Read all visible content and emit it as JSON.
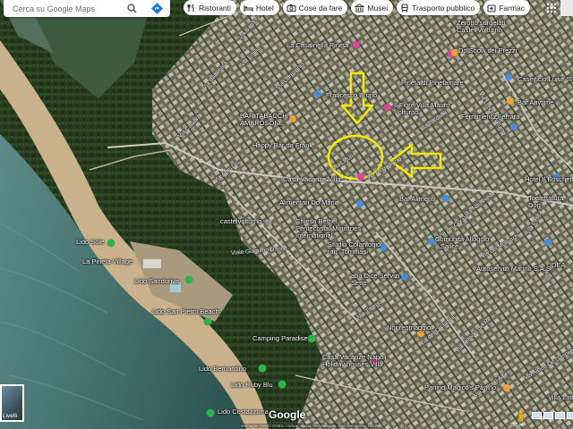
{
  "search": {
    "placeholder": "Cerca su Google Maps"
  },
  "chips": [
    {
      "label": "Ristoranti",
      "icon": "fork-knife-icon"
    },
    {
      "label": "Hotel",
      "icon": "bed-icon"
    },
    {
      "label": "Cose da fare",
      "icon": "camera-icon"
    },
    {
      "label": "Musei",
      "icon": "museum-icon"
    },
    {
      "label": "Trasporto pubblico",
      "icon": "train-icon"
    },
    {
      "label": "Farmac",
      "icon": "pharmacy-icon"
    }
  ],
  "map": {
    "places": {
      "castelvolturno": "Zerotto surgelati Castel Volturno",
      "showprezzi": "Do Show dei Prezzi",
      "casapineta": "La Casa nella Pineta",
      "caseificio": "Caseificio Luise S.r.l",
      "pineta": "Pineta di Pinetamare",
      "francesco": "Francesco Bruno",
      "barany": "Bar Anytime",
      "mauro": "Il Fiore Villa Mauro Volturno",
      "ferramenta": "Ferramenta Ferrara",
      "bambi": "BAR TABACCHI AMBROSONE",
      "happy": "Happy Bar da Frank",
      "hotel": "Hotel Il Boschetto",
      "toelettatura": "Toelettatura Dog",
      "casavacanze": "Casa Vacanze Villa",
      "alimentari": "Alimentari Do Maria",
      "bar_alimenti": "Bar Alimenti",
      "castelvolturno2": "castelvolturno",
      "chiesa": "Chiesa Bethel Pentecostal Ministries International",
      "studio": "Studio Colantonio rag. Tommasi",
      "comunita": "Comunità Alloggio Il Salice",
      "autoservizi": "Autoservizi Marino S.A.S",
      "idea": "IDEA",
      "aba": "aba Dice Servizi Sette",
      "lidosole": "Lido Sole",
      "pineta_village": "La Pineta Village",
      "sandoriva": "Lido Sandoriva",
      "sanpietro": "Lido San Pietro Beach",
      "camping": "Camping Paradise",
      "napoli": "Casa Vacanze Napoli Holiday houses Villa",
      "lidobernardino": "Lido Bernardino",
      "lidoruby": "Lido Ruby Blu",
      "lidocostazzurra": "Lido Costazzurra",
      "panino": "Panino Magico's Panino",
      "villa": "Villa Laura",
      "nonregmaggio": "Nonregmaggio"
    },
    "streets": {
      "s1": "Via Sardegna",
      "s2": "Via Basilicata",
      "s3": "Via Calabria",
      "s4": "Via Campania",
      "s5": "Via Abruzzo",
      "s6": "Via Liguria",
      "s7": "Via Mogadiscio",
      "s8": "Viale Giacomo Dance",
      "s9": "Via Lungo Volturno",
      "s10": "Via dei Coralli",
      "s11": "Via Nausicaa",
      "s12": "Via dei Molluschi",
      "s13": "Via Pesca",
      "s14": "Via dell'Orchidea",
      "s15": "Via Antonio del Re",
      "s16": "Via Vittorio Alfieri",
      "s17": "Via Alcide De Gasperi",
      "s18": "Via Tirreno",
      "s19": "Via Toscana",
      "s20": "Via Emilia"
    },
    "layers_label": "Livelli",
    "logo": "Google",
    "attribution": "Immagini ©2022 CNES / Airbus, Maxar Technologies, Dati cartografici ©2022",
    "scale": "200 m",
    "accent": "#f2ea00"
  }
}
